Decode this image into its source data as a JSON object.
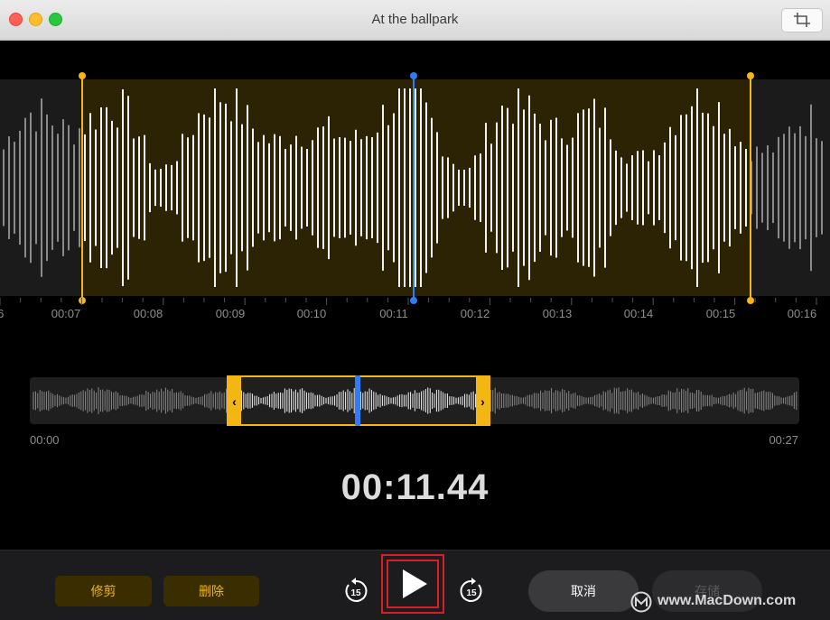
{
  "window": {
    "title": "At the ballpark"
  },
  "toolbar": {
    "crop_icon": "crop-icon"
  },
  "waveform": {
    "time_labels": [
      "6",
      "00:07",
      "00:08",
      "00:09",
      "00:10",
      "00:11",
      "00:12",
      "00:13",
      "00:14",
      "00:15",
      "00:16"
    ],
    "selection_color": "#f3b612",
    "playhead_color": "#2f7cf6"
  },
  "overview": {
    "start_time": "00:00",
    "end_time": "00:27",
    "selection_start_fraction": 0.26,
    "selection_end_fraction": 0.59,
    "playhead_fraction": 0.425
  },
  "playback": {
    "current_time": "00:11.44",
    "skip_back": "15",
    "skip_forward": "15"
  },
  "actions": {
    "trim_label": "修剪",
    "delete_label": "删除",
    "cancel_label": "取消",
    "save_label": "存储"
  },
  "watermark": {
    "text": "www.MacDown.com"
  }
}
